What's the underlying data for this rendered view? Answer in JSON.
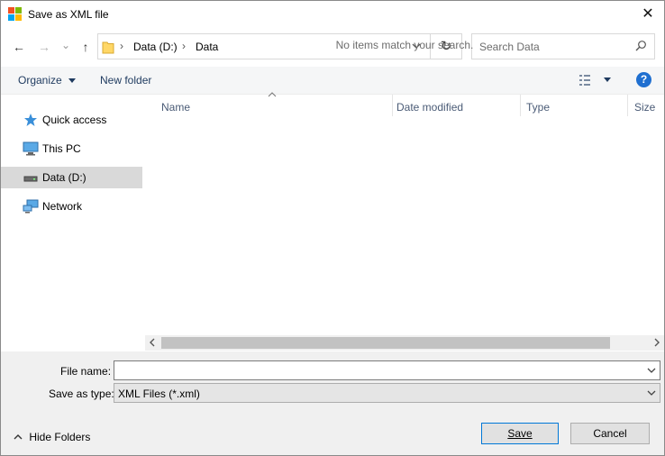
{
  "window": {
    "title": "Save as XML file",
    "close_glyph": "✕",
    "colors": {
      "red": "#f25022",
      "green": "#7fba00",
      "blue": "#00a4ef",
      "yellow": "#ffb900"
    }
  },
  "navigation": {
    "back_glyph": "←",
    "forward_glyph": "→",
    "recent_glyph": "⌄",
    "up_glyph": "↑",
    "breadcrumb": [
      "Data (D:)",
      "Data"
    ],
    "separator_glyph": "›",
    "refresh_glyph": "↻",
    "search_placeholder": "Search Data"
  },
  "toolbar": {
    "organize_label": "Organize",
    "new_folder_label": "New folder",
    "help_glyph": "?"
  },
  "nav_pane": {
    "items": [
      {
        "label": "Quick access",
        "icon": "star-icon"
      },
      {
        "label": "This PC",
        "icon": "monitor-icon"
      },
      {
        "label": "Data (D:)",
        "icon": "drive-icon",
        "selected": true
      },
      {
        "label": "Network",
        "icon": "network-icon"
      }
    ]
  },
  "file_list": {
    "columns": [
      "Name",
      "Date modified",
      "Type",
      "Size"
    ],
    "empty_message": "No items match your search."
  },
  "form": {
    "file_name_label": "File name:",
    "file_name_value": "",
    "save_type_label": "Save as type:",
    "save_type_value": "XML Files (*.xml)"
  },
  "footer": {
    "hide_folders_label": "Hide Folders",
    "save_label": "Save",
    "cancel_label": "Cancel"
  }
}
